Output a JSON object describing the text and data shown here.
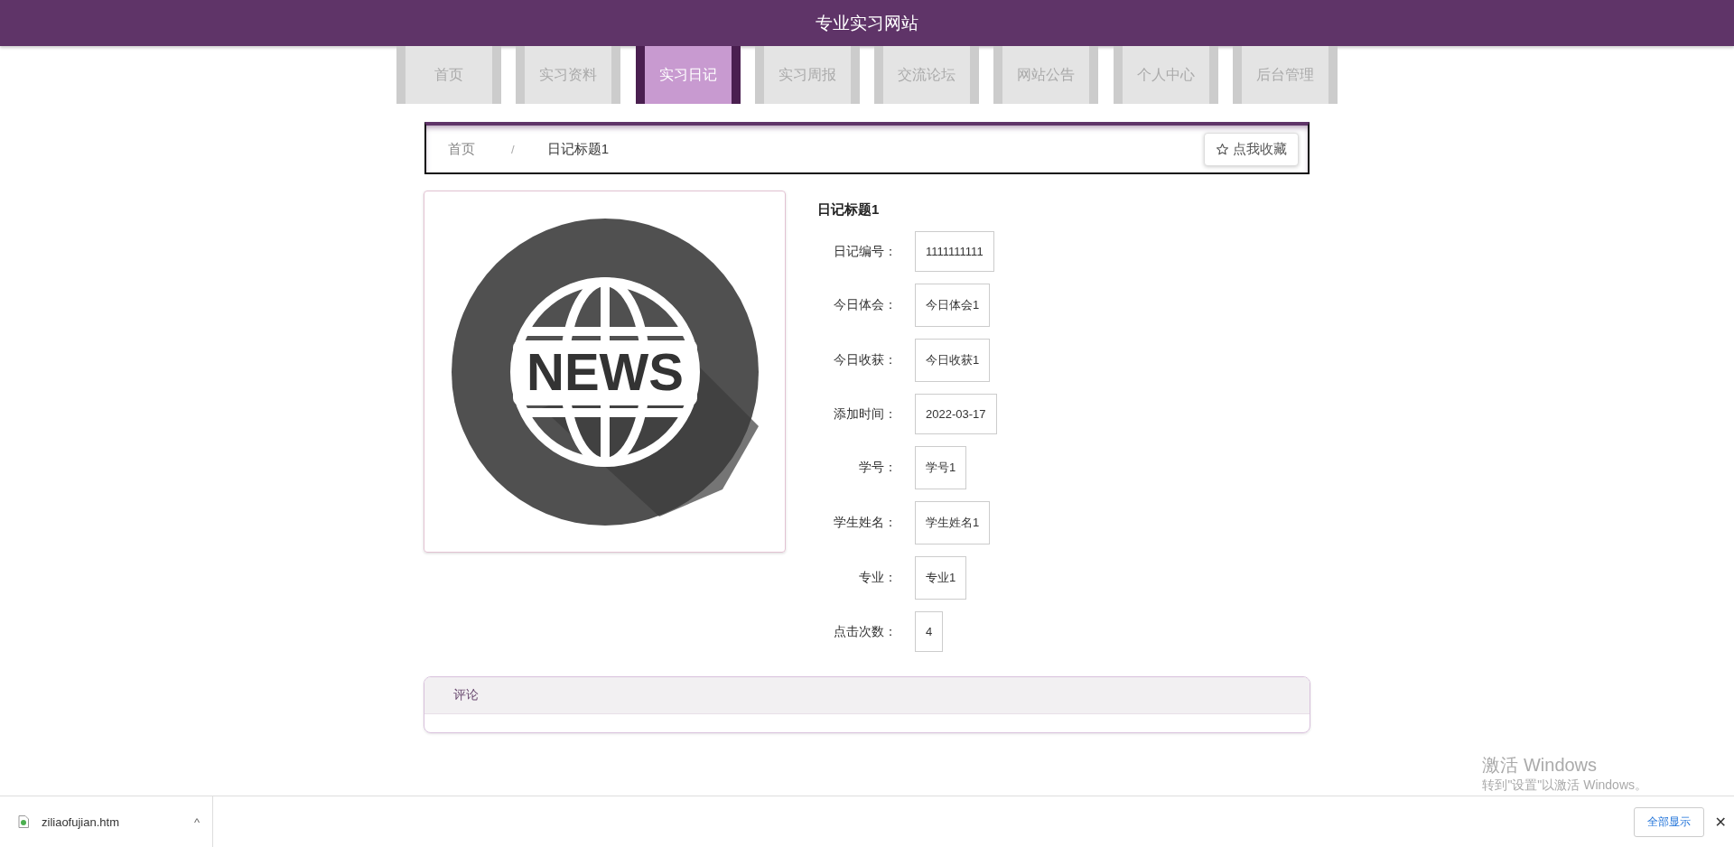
{
  "site_title": "专业实习网站",
  "nav": [
    {
      "label": "首页",
      "selected": false
    },
    {
      "label": "实习资料",
      "selected": false
    },
    {
      "label": "实习日记",
      "selected": true
    },
    {
      "label": "实习周报",
      "selected": false
    },
    {
      "label": "交流论坛",
      "selected": false
    },
    {
      "label": "网站公告",
      "selected": false
    },
    {
      "label": "个人中心",
      "selected": false
    },
    {
      "label": "后台管理",
      "selected": false
    }
  ],
  "breadcrumb": {
    "home": "首页",
    "separator": "/",
    "current": "日记标题1",
    "favorite_button": "点我收藏"
  },
  "image": {
    "badge_text": "NEWS"
  },
  "detail": {
    "title": "日记标题1",
    "fields": [
      {
        "label": "日记编号：",
        "value": "1111111111"
      },
      {
        "label": "今日体会：",
        "value": "今日体会1"
      },
      {
        "label": "今日收获：",
        "value": "今日收获1"
      },
      {
        "label": "添加时间：",
        "value": "2022-03-17"
      },
      {
        "label": "学号：",
        "value": "学号1"
      },
      {
        "label": "学生姓名：",
        "value": "学生姓名1"
      },
      {
        "label": "专业：",
        "value": "专业1"
      },
      {
        "label": "点击次数：",
        "value": "4"
      }
    ]
  },
  "comments": {
    "title": "评论"
  },
  "activation": {
    "title": "激活 Windows",
    "subtitle": "转到\"设置\"以激活 Windows。"
  },
  "download_bar": {
    "file": "ziliaofujian.htm",
    "show_all": "全部显示",
    "close": "✕",
    "caret": "^"
  }
}
